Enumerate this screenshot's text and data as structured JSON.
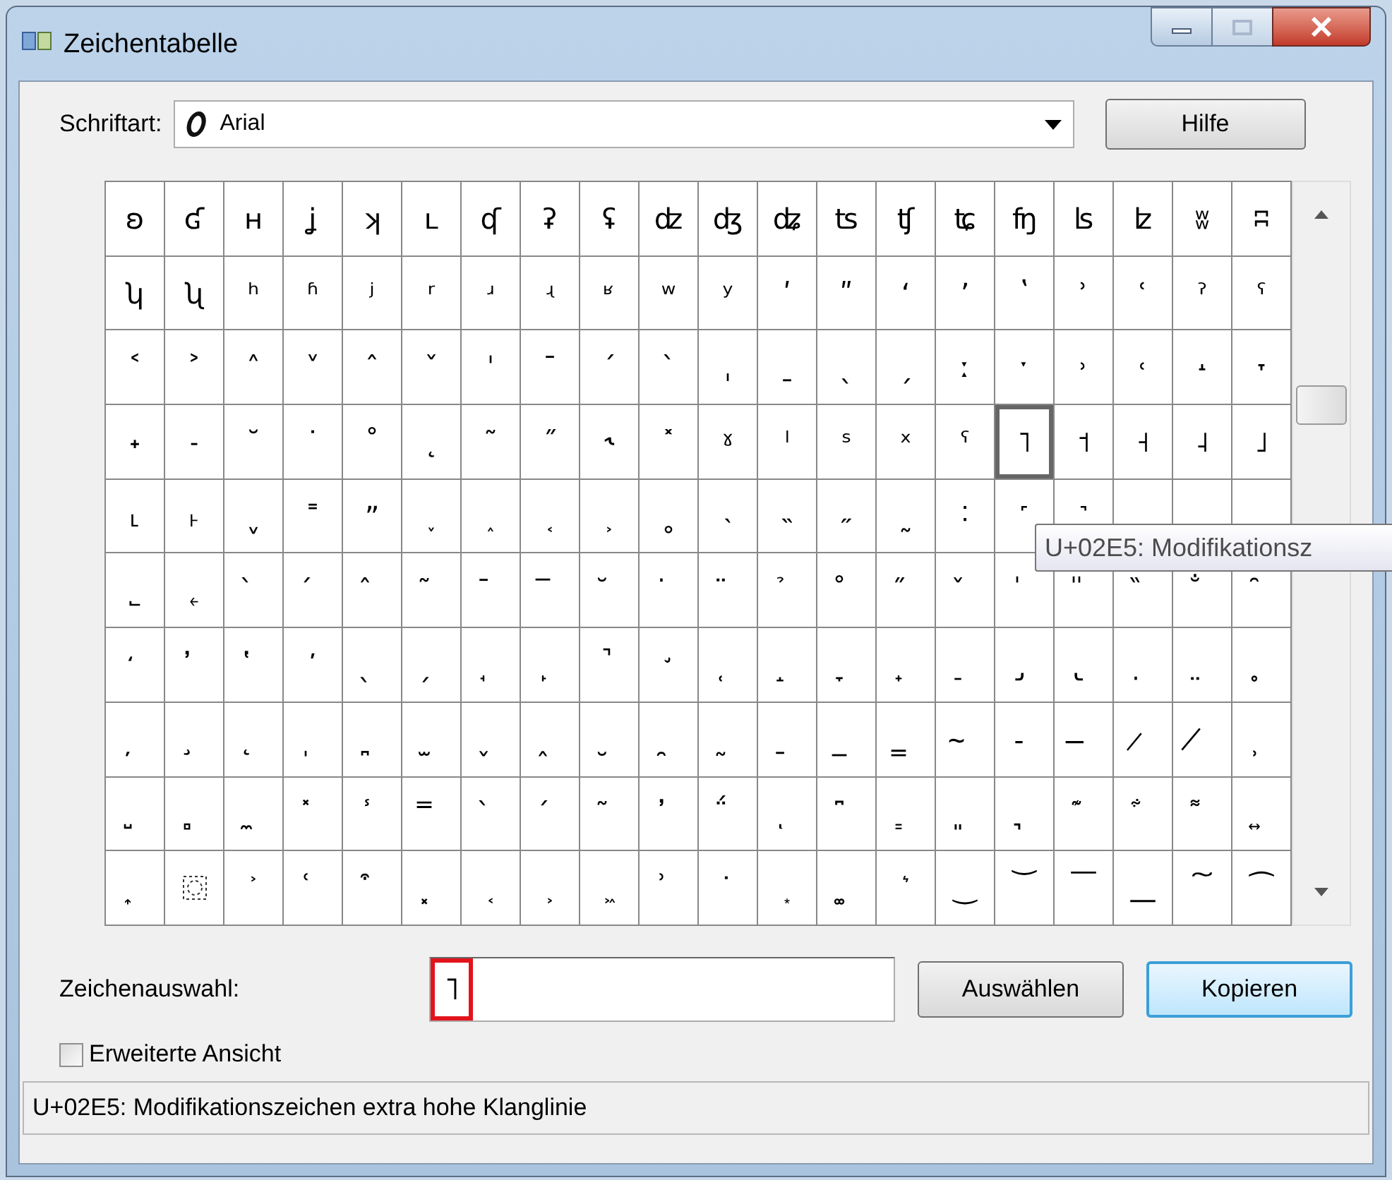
{
  "window": {
    "title": "Zeichentabelle"
  },
  "font_select": {
    "label": "Schriftart:",
    "value": "Arial"
  },
  "help_button": "Hilfe",
  "grid": {
    "rows": [
      {
        "cells": [
          {
            "char": "ʚ",
            "selected": false
          },
          {
            "char": "ʛ",
            "selected": false
          },
          {
            "char": "ʜ",
            "selected": false
          },
          {
            "char": "ʝ",
            "selected": false
          },
          {
            "char": "ʞ",
            "selected": false
          },
          {
            "char": "ʟ",
            "selected": false
          },
          {
            "char": "ʠ",
            "selected": false
          },
          {
            "char": "ʡ",
            "selected": false
          },
          {
            "char": "ʢ",
            "selected": false
          },
          {
            "char": "ʣ",
            "selected": false
          },
          {
            "char": "ʤ",
            "selected": false
          },
          {
            "char": "ʥ",
            "selected": false
          },
          {
            "char": "ʦ",
            "selected": false
          },
          {
            "char": "ʧ",
            "selected": false
          },
          {
            "char": "ʨ",
            "selected": false
          },
          {
            "char": "ʩ",
            "selected": false
          },
          {
            "char": "ʪ",
            "selected": false
          },
          {
            "char": "ʫ",
            "selected": false
          },
          {
            "char": "ʬ",
            "selected": false
          },
          {
            "char": "ʭ",
            "selected": false
          }
        ]
      },
      {
        "cells": [
          {
            "char": "ʮ",
            "selected": false
          },
          {
            "char": "ʯ",
            "selected": false
          },
          {
            "char": "ʰ",
            "selected": false
          },
          {
            "char": "ʱ",
            "selected": false
          },
          {
            "char": "ʲ",
            "selected": false
          },
          {
            "char": "ʳ",
            "selected": false
          },
          {
            "char": "ʴ",
            "selected": false
          },
          {
            "char": "ʵ",
            "selected": false
          },
          {
            "char": "ʶ",
            "selected": false
          },
          {
            "char": "ʷ",
            "selected": false
          },
          {
            "char": "ʸ",
            "selected": false
          },
          {
            "char": "ʹ",
            "selected": false
          },
          {
            "char": "ʺ",
            "selected": false
          },
          {
            "char": "ʻ",
            "selected": false
          },
          {
            "char": "ʼ",
            "selected": false
          },
          {
            "char": "ʽ",
            "selected": false
          },
          {
            "char": "ʾ",
            "selected": false
          },
          {
            "char": "ʿ",
            "selected": false
          },
          {
            "char": "ˀ",
            "selected": false
          },
          {
            "char": "ˁ",
            "selected": false
          }
        ]
      },
      {
        "cells": [
          {
            "char": "˂",
            "selected": false
          },
          {
            "char": "˃",
            "selected": false
          },
          {
            "char": "˄",
            "selected": false
          },
          {
            "char": "˅",
            "selected": false
          },
          {
            "char": "ˆ",
            "selected": false
          },
          {
            "char": "ˇ",
            "selected": false
          },
          {
            "char": "ˈ",
            "selected": false
          },
          {
            "char": "ˉ",
            "selected": false
          },
          {
            "char": "ˊ",
            "selected": false
          },
          {
            "char": "ˋ",
            "selected": false
          },
          {
            "char": "ˌ",
            "selected": false
          },
          {
            "char": "ˍ",
            "selected": false
          },
          {
            "char": "ˎ",
            "selected": false
          },
          {
            "char": "ˏ",
            "selected": false
          },
          {
            "char": "ː",
            "selected": false
          },
          {
            "char": "ˑ",
            "selected": false
          },
          {
            "char": "˒",
            "selected": false
          },
          {
            "char": "˓",
            "selected": false
          },
          {
            "char": "˔",
            "selected": false
          },
          {
            "char": "˕",
            "selected": false
          }
        ]
      },
      {
        "cells": [
          {
            "char": "˖",
            "selected": false
          },
          {
            "char": "˗",
            "selected": false
          },
          {
            "char": "˘",
            "selected": false
          },
          {
            "char": "˙",
            "selected": false
          },
          {
            "char": "˚",
            "selected": false
          },
          {
            "char": "˛",
            "selected": false
          },
          {
            "char": "˜",
            "selected": false
          },
          {
            "char": "˝",
            "selected": false
          },
          {
            "char": "˞",
            "selected": false
          },
          {
            "char": "˟",
            "selected": false
          },
          {
            "char": "ˠ",
            "selected": false
          },
          {
            "char": "ˡ",
            "selected": false
          },
          {
            "char": "ˢ",
            "selected": false
          },
          {
            "char": "ˣ",
            "selected": false
          },
          {
            "char": "ˤ",
            "selected": false
          },
          {
            "char": "˥",
            "selected": true
          },
          {
            "char": "˦",
            "selected": false
          },
          {
            "char": "˧",
            "selected": false
          },
          {
            "char": "˨",
            "selected": false
          },
          {
            "char": "˩",
            "selected": false
          }
        ]
      },
      {
        "cells": [
          {
            "char": "˪",
            "selected": false
          },
          {
            "char": "˫",
            "selected": false
          },
          {
            "char": "ˬ",
            "selected": false
          },
          {
            "char": "˭",
            "selected": false
          },
          {
            "char": "ˮ",
            "selected": false
          },
          {
            "char": "˯",
            "selected": false
          },
          {
            "char": "˰",
            "selected": false
          },
          {
            "char": "˱",
            "selected": false
          },
          {
            "char": "˲",
            "selected": false
          },
          {
            "char": "˳",
            "selected": false
          },
          {
            "char": "˴",
            "selected": false
          },
          {
            "char": "˵",
            "selected": false
          },
          {
            "char": "˶",
            "selected": false
          },
          {
            "char": "˷",
            "selected": false
          },
          {
            "char": "˸",
            "selected": false
          },
          {
            "char": "˹",
            "selected": false
          },
          {
            "char": "˺",
            "selected": false
          },
          {
            "selected": false
          },
          {
            "selected": false
          },
          {
            "selected": false
          }
        ]
      },
      {
        "cells": [
          {
            "char": "˾",
            "selected": false
          },
          {
            "char": "˿",
            "selected": false
          },
          {
            "char": "̀",
            "selected": false
          },
          {
            "char": "́",
            "selected": false
          },
          {
            "char": "̂",
            "selected": false
          },
          {
            "char": "̃",
            "selected": false
          },
          {
            "char": "̄",
            "selected": false
          },
          {
            "char": "̅",
            "selected": false
          },
          {
            "char": "̆",
            "selected": false
          },
          {
            "char": "̇",
            "selected": false
          },
          {
            "char": "̈",
            "selected": false
          },
          {
            "char": "̉",
            "selected": false
          },
          {
            "char": "̊",
            "selected": false
          },
          {
            "char": "̋",
            "selected": false
          },
          {
            "char": "̌",
            "selected": false
          },
          {
            "char": "̍",
            "selected": false
          },
          {
            "char": "̎",
            "selected": false
          },
          {
            "char": "̏",
            "selected": false
          },
          {
            "char": "̐",
            "selected": false
          },
          {
            "char": "̑",
            "selected": false
          }
        ]
      },
      {
        "cells": [
          {
            "char": "̒",
            "selected": false
          },
          {
            "char": "̓",
            "selected": false
          },
          {
            "char": "̔",
            "selected": false
          },
          {
            "char": "̕",
            "selected": false
          },
          {
            "char": "̖",
            "selected": false
          },
          {
            "char": "̗",
            "selected": false
          },
          {
            "char": "̘",
            "selected": false
          },
          {
            "char": "̙",
            "selected": false
          },
          {
            "char": "̚",
            "selected": false
          },
          {
            "char": "̛",
            "selected": false
          },
          {
            "char": "̜",
            "selected": false
          },
          {
            "char": "̝",
            "selected": false
          },
          {
            "char": "̞",
            "selected": false
          },
          {
            "char": "̟",
            "selected": false
          },
          {
            "char": "̠",
            "selected": false
          },
          {
            "char": "̡",
            "selected": false
          },
          {
            "char": "̢",
            "selected": false
          },
          {
            "char": "̣",
            "selected": false
          },
          {
            "char": "̤",
            "selected": false
          },
          {
            "char": "̥",
            "selected": false
          }
        ]
      },
      {
        "cells": [
          {
            "char": "̦",
            "selected": false
          },
          {
            "char": "̧",
            "selected": false
          },
          {
            "char": "̨",
            "selected": false
          },
          {
            "char": "̩",
            "selected": false
          },
          {
            "char": "̪",
            "selected": false
          },
          {
            "char": "̫",
            "selected": false
          },
          {
            "char": "̬",
            "selected": false
          },
          {
            "char": "̭",
            "selected": false
          },
          {
            "char": "̮",
            "selected": false
          },
          {
            "char": "̯",
            "selected": false
          },
          {
            "char": "̰",
            "selected": false
          },
          {
            "char": "̱",
            "selected": false
          },
          {
            "char": "̲",
            "selected": false
          },
          {
            "char": "̳",
            "selected": false
          },
          {
            "char": "̴",
            "selected": false
          },
          {
            "char": "̵",
            "selected": false
          },
          {
            "char": "̶",
            "selected": false
          },
          {
            "char": "̷",
            "selected": false
          },
          {
            "char": "̸",
            "selected": false
          },
          {
            "char": "̹",
            "selected": false
          }
        ]
      },
      {
        "cells": [
          {
            "char": "̺",
            "selected": false
          },
          {
            "char": "̻",
            "selected": false
          },
          {
            "char": "̼",
            "selected": false
          },
          {
            "char": "̽",
            "selected": false
          },
          {
            "char": "̾",
            "selected": false
          },
          {
            "char": "̿",
            "selected": false
          },
          {
            "char": "̀",
            "selected": false
          },
          {
            "char": "́",
            "selected": false
          },
          {
            "char": "͂",
            "selected": false
          },
          {
            "char": "̓",
            "selected": false
          },
          {
            "char": "̈́",
            "selected": false
          },
          {
            "char": "ͅ",
            "selected": false
          },
          {
            "char": "͆",
            "selected": false
          },
          {
            "char": "͇",
            "selected": false
          },
          {
            "char": "͈",
            "selected": false
          },
          {
            "char": "͉",
            "selected": false
          },
          {
            "char": "͊",
            "selected": false
          },
          {
            "char": "͋",
            "selected": false
          },
          {
            "char": "͌",
            "selected": false
          },
          {
            "char": "͍",
            "selected": false
          }
        ]
      },
      {
        "cells": [
          {
            "char": "͎",
            "selected": false
          },
          {
            "kind": "dotted_box",
            "selected": false
          },
          {
            "char": "͐",
            "selected": false
          },
          {
            "char": "͑",
            "selected": false
          },
          {
            "char": "͒",
            "selected": false
          },
          {
            "char": "͓",
            "selected": false
          },
          {
            "char": "͔",
            "selected": false
          },
          {
            "char": "͕",
            "selected": false
          },
          {
            "char": "͖",
            "selected": false
          },
          {
            "char": "͗",
            "selected": false
          },
          {
            "char": "͘",
            "selected": false
          },
          {
            "char": "͙",
            "selected": false
          },
          {
            "char": "͚",
            "selected": false
          },
          {
            "char": "͛",
            "selected": false
          },
          {
            "char": "͜",
            "selected": false
          },
          {
            "char": "͝",
            "selected": false
          },
          {
            "char": "͞",
            "selected": false
          },
          {
            "char": "͟",
            "selected": false
          },
          {
            "char": "͠",
            "selected": false
          },
          {
            "char": "͡",
            "selected": false
          }
        ]
      }
    ]
  },
  "tooltip": "U+02E5: Modifikationsz",
  "selection": {
    "label": "Zeichenauswahl:",
    "value": "˥"
  },
  "buttons": [
    {
      "label": "Auswählen",
      "default": false
    },
    {
      "label": "Kopieren",
      "default": true
    }
  ],
  "advanced_view": {
    "label": "Erweiterte Ansicht",
    "checked": false
  },
  "status_bar": "U+02E5: Modifikationszeichen extra hohe Klanglinie"
}
